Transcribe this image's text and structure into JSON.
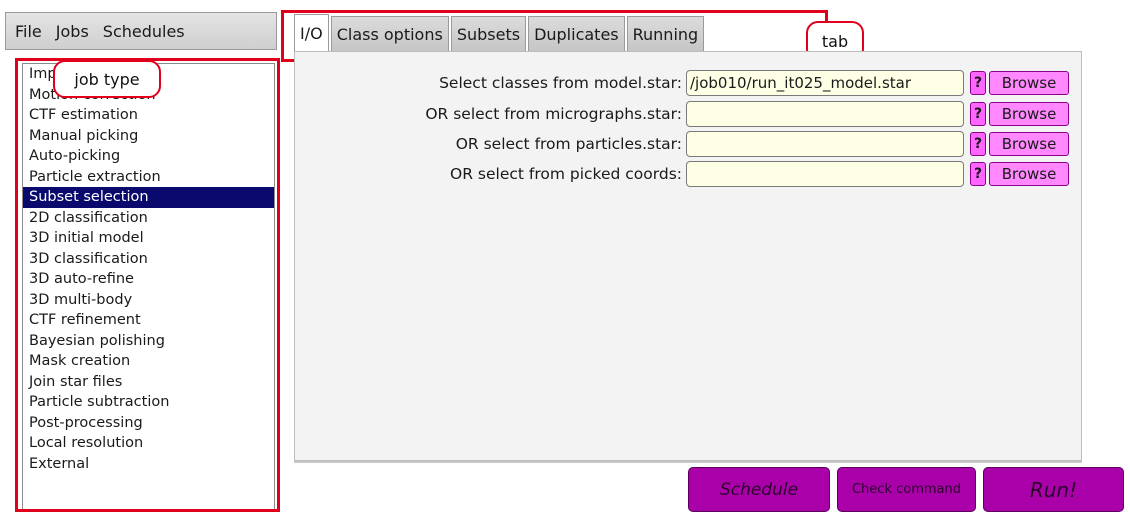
{
  "menu": [
    "File",
    "Jobs",
    "Schedules"
  ],
  "annotations": {
    "job_type": "job type",
    "tab": "tab"
  },
  "job_types": [
    "Import",
    "Motion correction",
    "CTF estimation",
    "Manual picking",
    "Auto-picking",
    "Particle extraction",
    "Subset selection",
    "2D classification",
    "3D initial model",
    "3D classification",
    "3D auto-refine",
    "3D multi-body",
    "CTF refinement",
    "Bayesian polishing",
    "Mask creation",
    "Join star files",
    "Particle subtraction",
    "Post-processing",
    "Local resolution",
    "External"
  ],
  "selected_job_type": "Subset selection",
  "tabs": [
    "I/O",
    "Class options",
    "Subsets",
    "Duplicates",
    "Running"
  ],
  "active_tab": "I/O",
  "fields": [
    {
      "label": "Select classes from model.star:",
      "value": "/job010/run_it025_model.star",
      "help": "?",
      "browse": "Browse"
    },
    {
      "label": "OR select from micrographs.star:",
      "value": "",
      "help": "?",
      "browse": "Browse"
    },
    {
      "label": "OR select from particles.star:",
      "value": "",
      "help": "?",
      "browse": "Browse"
    },
    {
      "label": "OR select from picked coords:",
      "value": "",
      "help": "?",
      "browse": "Browse"
    }
  ],
  "actions": {
    "schedule": "Schedule",
    "check_command": "Check command",
    "run": "Run!"
  },
  "colors": {
    "selection": "#0a0a6e",
    "input_background": "#ffffe6",
    "button_pink": "#ff88ff",
    "action_purple": "#aa00aa",
    "annotation_red": "#e0001b"
  }
}
